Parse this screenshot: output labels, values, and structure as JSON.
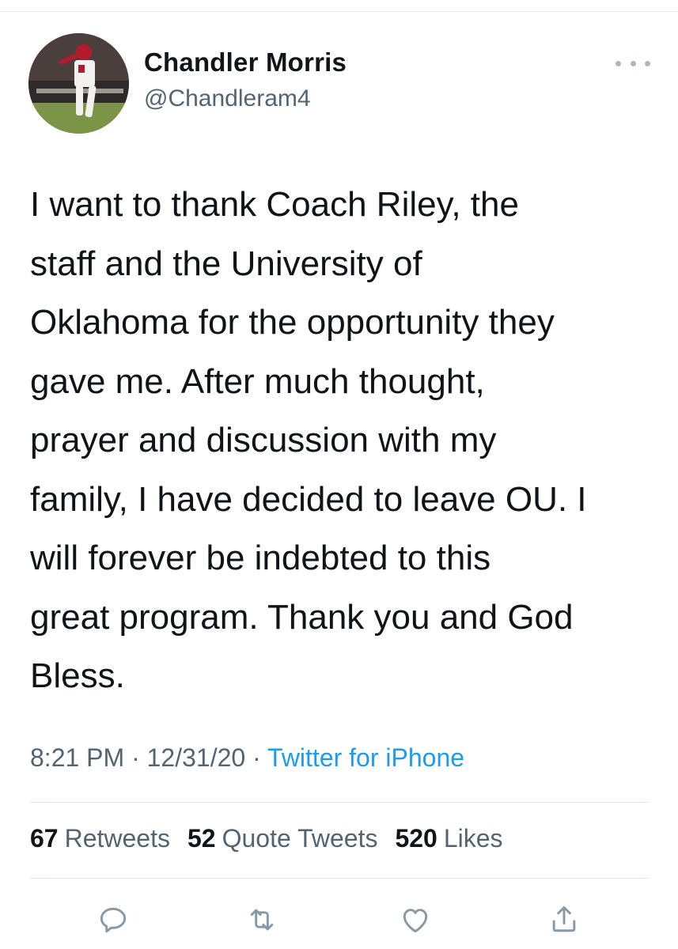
{
  "tweet": {
    "author": {
      "display_name": "Chandler Morris",
      "handle": "@Chandleram4"
    },
    "text": "I want to thank Coach Riley, the\nstaff and the University of\nOklahoma for the opportunity they\ngave me. After much thought,\nprayer and discussion with my\nfamily, I have decided to leave OU. I\nwill forever be indebted to this\ngreat program. Thank you and God\nBless.",
    "time": "8:21 PM",
    "date": "12/31/20",
    "separator": "·",
    "source": "Twitter for iPhone"
  },
  "stats": {
    "retweets": {
      "count": "67",
      "label": "Retweets"
    },
    "quotes": {
      "count": "52",
      "label": "Quote Tweets"
    },
    "likes": {
      "count": "520",
      "label": "Likes"
    }
  },
  "actions": {
    "icons": [
      "reply-icon",
      "retweet-icon",
      "like-icon",
      "share-icon"
    ],
    "icon_color": "#8899a6"
  },
  "colors": {
    "link": "#1d9bf0",
    "secondary_text": "#536471",
    "primary_text": "#0f1419"
  }
}
